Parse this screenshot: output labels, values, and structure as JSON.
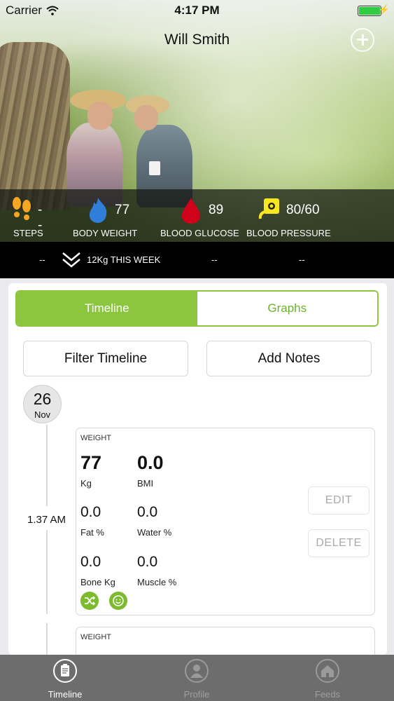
{
  "status_bar": {
    "carrier": "Carrier",
    "time": "4:17 PM"
  },
  "header": {
    "title": "Will Smith"
  },
  "metrics": [
    {
      "label": "STEPS",
      "value": "--",
      "color": "#f5a623",
      "icon": "footprints-icon"
    },
    {
      "label": "BODY WEIGHT",
      "value": "77",
      "color": "#2f7fd8",
      "icon": "flame-icon"
    },
    {
      "label": "BLOOD GLUCOSE",
      "value": "89",
      "color": "#d0021b",
      "icon": "blood-drop-icon"
    },
    {
      "label": "BLOOD PRESSURE",
      "value": "80/60",
      "color": "#f8e71c",
      "icon": "bp-monitor-icon"
    }
  ],
  "week_bar": {
    "col1": "--",
    "weekly_change": "12Kg THIS WEEK",
    "col3": "--",
    "col4": "--"
  },
  "tabs": {
    "timeline": "Timeline",
    "graphs": "Graphs"
  },
  "actions": {
    "filter": "Filter Timeline",
    "notes": "Add Notes"
  },
  "date": {
    "day": "26",
    "month": "Nov"
  },
  "entry": {
    "time": "1.37 AM",
    "type": "WEIGHT",
    "weight": {
      "value": "77",
      "label": "Kg"
    },
    "bmi": {
      "value": "0.0",
      "label": "BMI"
    },
    "fat": {
      "value": "0.0",
      "label": "Fat %"
    },
    "water": {
      "value": "0.0",
      "label": "Water %"
    },
    "bone": {
      "value": "0.0",
      "label": "Bone Kg"
    },
    "muscle": {
      "value": "0.0",
      "label": "Muscle %"
    },
    "edit_label": "EDIT",
    "delete_label": "DELETE"
  },
  "entry2": {
    "type": "WEIGHT"
  },
  "bottom_tabs": [
    {
      "label": "Timeline"
    },
    {
      "label": "Profile"
    },
    {
      "label": "Feeds"
    }
  ],
  "colors": {
    "accent_green": "#8cc63f",
    "tabbar": "#6d6d6d"
  }
}
